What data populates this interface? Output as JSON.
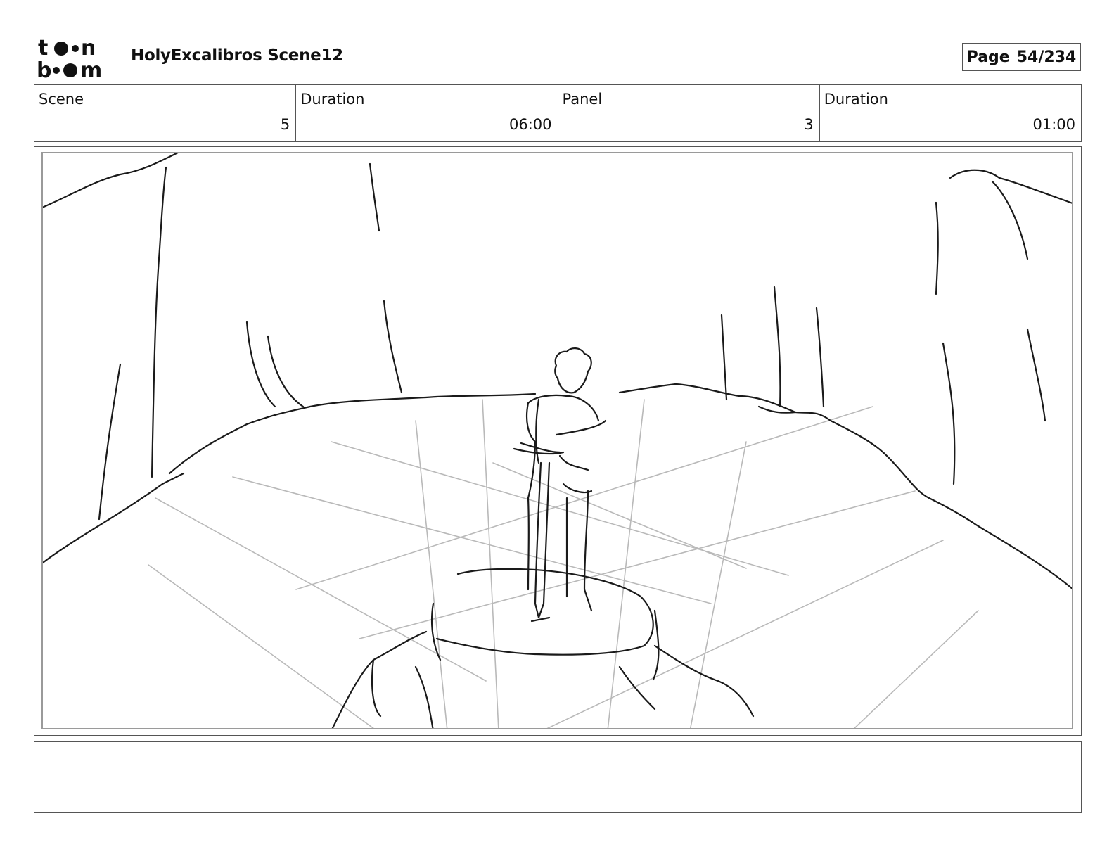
{
  "header": {
    "logo_text": "toon boom",
    "project_title": "HolyExcalibros Scene12",
    "page_label": "Page",
    "page_number": "54/234"
  },
  "info": {
    "scene": {
      "label": "Scene",
      "value": "5"
    },
    "scene_duration": {
      "label": "Duration",
      "value": "06:00"
    },
    "panel": {
      "label": "Panel",
      "value": "3"
    },
    "panel_duration": {
      "label": "Duration",
      "value": "01:00"
    }
  },
  "notes": {
    "text": ""
  }
}
